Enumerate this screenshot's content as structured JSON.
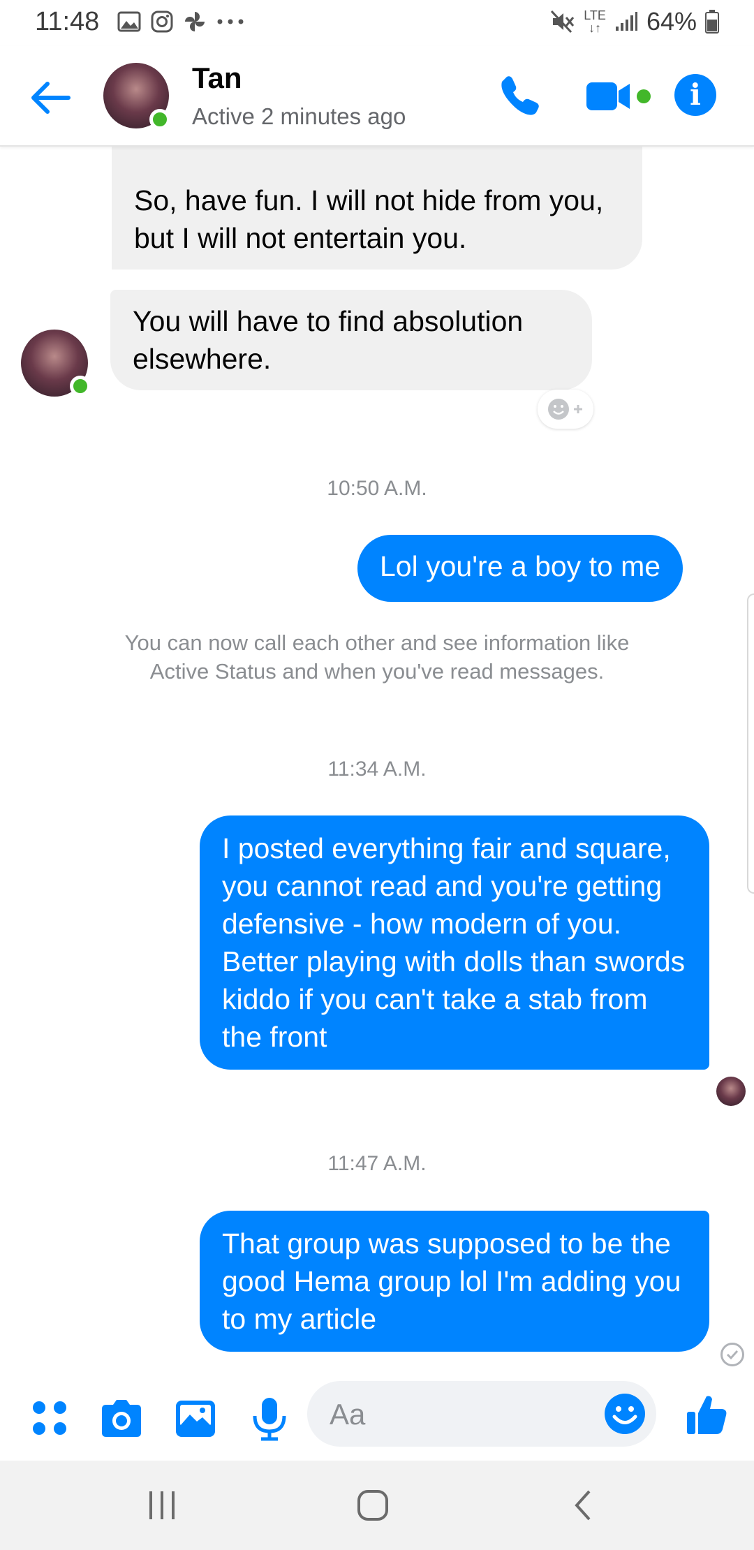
{
  "status_bar": {
    "time": "11:48",
    "battery": "64%",
    "network": "LTE",
    "left_icons": [
      "gallery-icon",
      "instagram-icon",
      "pinwheel-icon",
      "more-dots-icon"
    ],
    "right_icons": [
      "mute-icon",
      "lte-icon",
      "signal-icon",
      "battery-icon"
    ]
  },
  "header": {
    "name": "Tan",
    "status": "Active 2 minutes ago",
    "accent": "#0084ff",
    "online_color": "#42b72a"
  },
  "messages": {
    "in1_text": "which also will not fly.\n\nSo, have fun. I will not hide from you, but I will not entertain you.",
    "in2_text": "You will have to find absolution elsewhere.",
    "ts1": "10:50 A.M.",
    "out1": "Lol you're a boy to me",
    "system_notice": "You can now call each other and see information like Active Status and when you've read messages.",
    "ts2": "11:34 A.M.",
    "out2": "I posted everything fair and square, you cannot read and you're getting defensive - how modern of you. Better playing with dolls than swords kiddo if you can't take a stab from the front",
    "ts3": "11:47 A.M.",
    "out3": "That group was supposed to be the good Hema group lol I'm adding you to my article"
  },
  "composer": {
    "placeholder": "Aa",
    "icons": [
      "apps-icon",
      "camera-icon",
      "gallery-icon",
      "microphone-icon",
      "emoji-icon",
      "thumbs-up-icon"
    ]
  },
  "nav_bar": {
    "icons": [
      "recent-apps-icon",
      "home-icon",
      "back-icon"
    ]
  }
}
